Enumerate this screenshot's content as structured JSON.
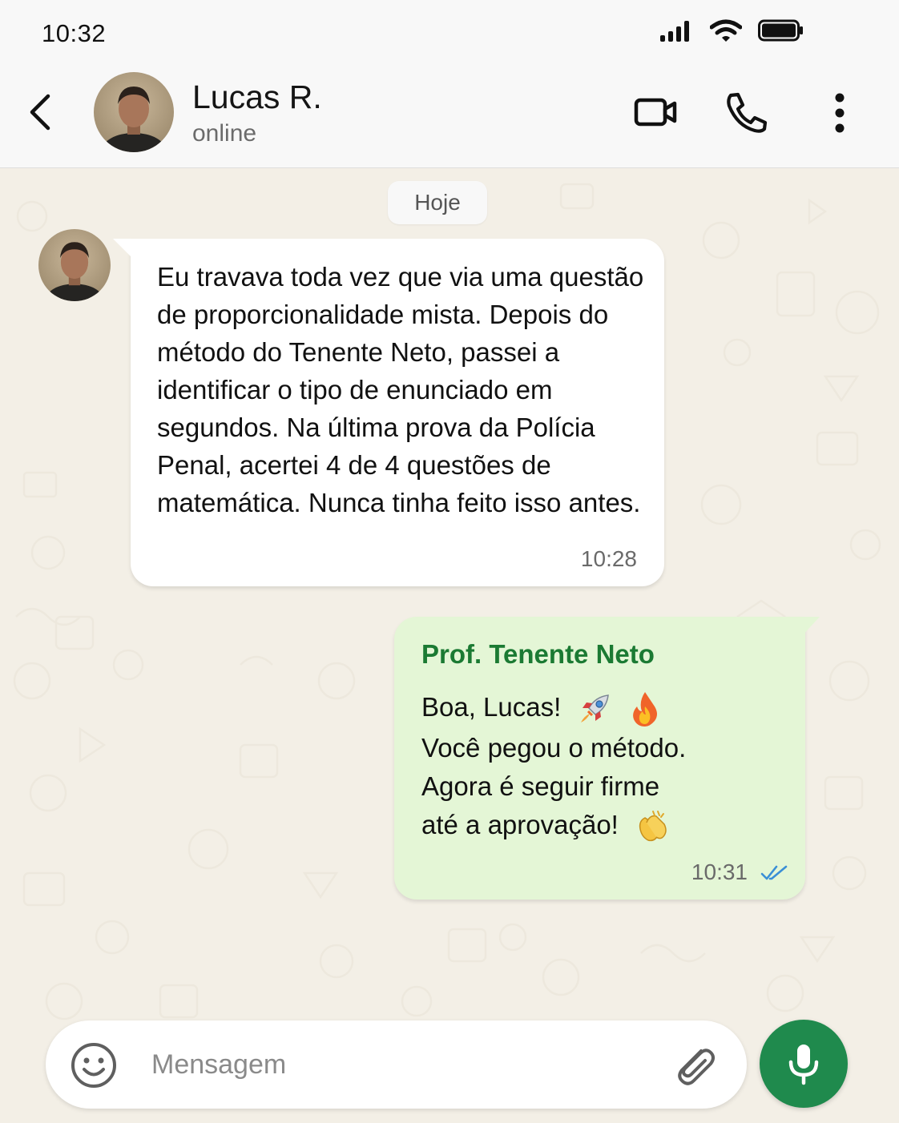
{
  "status_bar": {
    "time": "10:32"
  },
  "header": {
    "contact_name": "Lucas R.",
    "contact_status": "online"
  },
  "chat": {
    "date_separator": "Hoje",
    "messages": [
      {
        "direction": "incoming",
        "text": "Eu travava toda vez que via uma questão de proporcionalidade mista. Depois do método do Tenente Neto, passei a identificar o tipo de enunciado em segundos. Na última prova da Polícia Penal, acertei 4 de 4 questões de matemática. Nunca tinha feito isso antes.",
        "time": "10:28"
      },
      {
        "direction": "outgoing",
        "sender": "Prof. Tenente Neto",
        "lines": [
          "Boa, Lucas!",
          "Você pegou o método.",
          "Agora é seguir firme",
          "até a aprovação!"
        ],
        "emojis": [
          "rocket-emoji",
          "fire-emoji",
          "clapping-hands-emoji"
        ],
        "time": "10:31",
        "status": "read"
      }
    ]
  },
  "input": {
    "placeholder": "Mensagem"
  },
  "colors": {
    "chat_background": "#f3efe6",
    "outgoing_bubble": "#e4f6d6",
    "sender_name": "#1b7a33",
    "mic_button": "#1f8a4d",
    "read_ticks": "#3a8fd6"
  }
}
